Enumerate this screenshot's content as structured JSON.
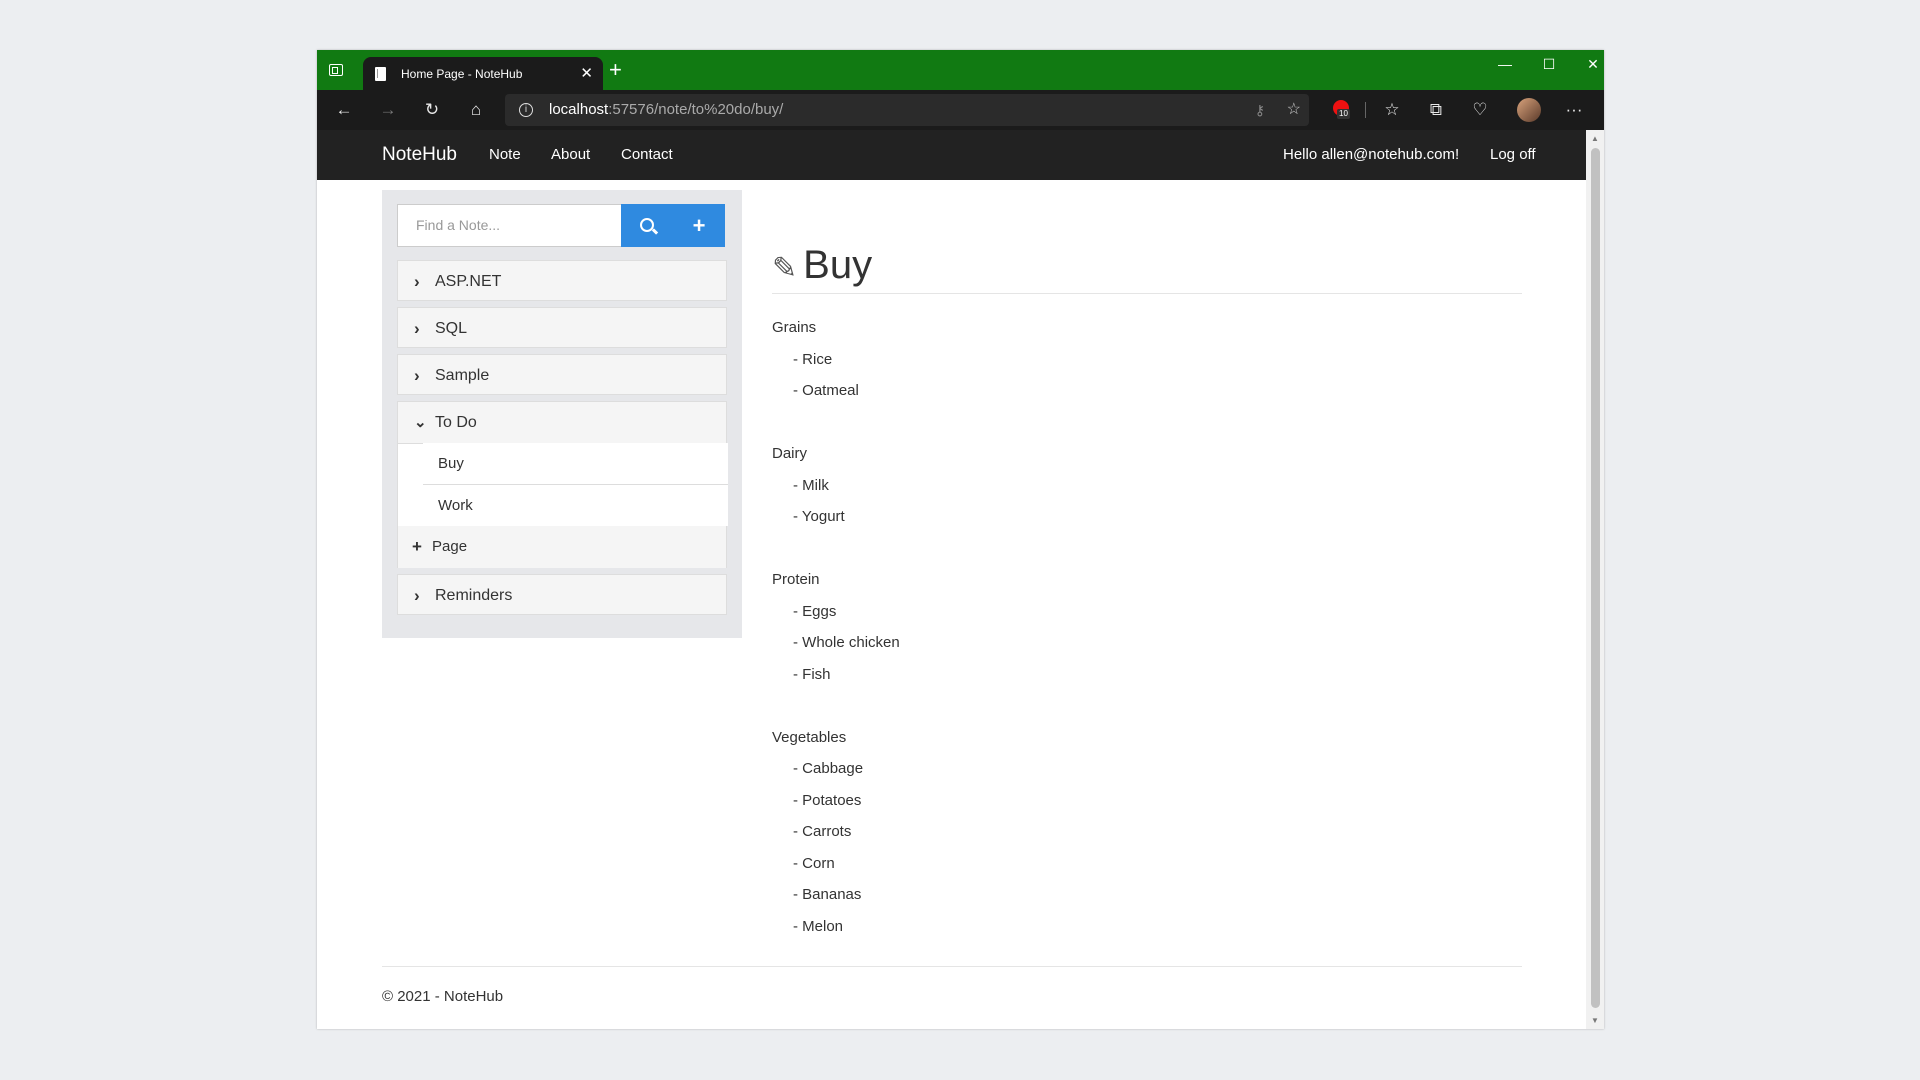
{
  "browser": {
    "tab_title": "Home Page - NoteHub",
    "tab_close": "✕",
    "new_tab": "+",
    "window_controls": {
      "minimize": "—",
      "maximize": "☐",
      "close": "✕"
    },
    "url_host": "localhost",
    "url_rest": ":57576/note/to%20do/buy/",
    "extension_badge": "10",
    "more": "···"
  },
  "navbar": {
    "brand": "NoteHub",
    "links": [
      "Note",
      "About",
      "Contact"
    ],
    "greeting": "Hello allen@notehub.com!",
    "logoff": "Log off"
  },
  "sidebar": {
    "search_placeholder": "Find a Note...",
    "categories": [
      "ASP.NET",
      "SQL",
      "Sample"
    ],
    "expanded_category": "To Do",
    "expanded_pages": [
      "Buy",
      "Work"
    ],
    "add_page_label": "Page",
    "last_category": "Reminders"
  },
  "note": {
    "title": "Buy",
    "sections": [
      {
        "heading": "Grains",
        "items": [
          "Rice",
          "Oatmeal"
        ]
      },
      {
        "heading": "Dairy",
        "items": [
          "Milk",
          "Yogurt"
        ]
      },
      {
        "heading": "Protein",
        "items": [
          "Eggs",
          "Whole chicken",
          "Fish"
        ]
      },
      {
        "heading": "Vegetables",
        "items": [
          "Cabbage",
          "Potatoes",
          "Carrots",
          "Corn",
          "Bananas",
          "Melon"
        ]
      }
    ]
  },
  "footer": {
    "text": "© 2021 - NoteHub"
  },
  "colors": {
    "titlebar": "#117a12",
    "navbar": "#222222",
    "button": "#2f8ae0",
    "sidebar": "#e6e7ea"
  }
}
